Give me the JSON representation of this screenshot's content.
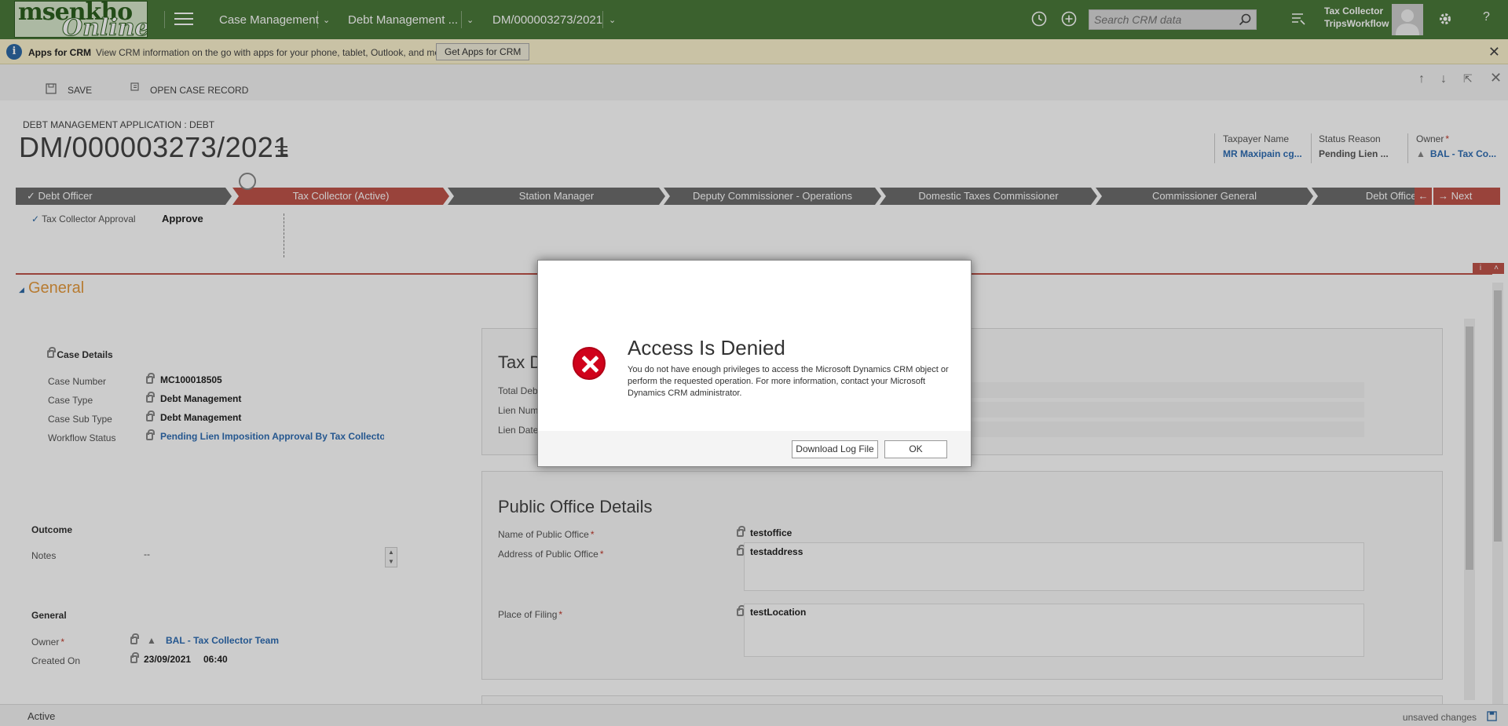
{
  "logo": {
    "line1": "msenkho",
    "line2": "Online"
  },
  "topbar": {
    "nav": [
      "Case Management",
      "Debt Management ...",
      "DM/000003273/2021"
    ],
    "search_placeholder": "Search CRM data",
    "user_line1": "Tax Collector",
    "user_line2": "TripsWorkflow",
    "help": "?"
  },
  "notification": {
    "title": "Apps for CRM",
    "message": "View CRM information on the go with apps for your phone, tablet, Outlook, and more!",
    "button": "Get Apps for CRM"
  },
  "commands": {
    "save": "SAVE",
    "open_case": "OPEN CASE RECORD"
  },
  "header": {
    "entity_type": "DEBT MANAGEMENT APPLICATION : DEBT",
    "title": "DM/000003273/2021",
    "fields": [
      {
        "label": "Taxpayer Name",
        "value": "MR Maxipain cg..."
      },
      {
        "label": "Status Reason",
        "value": "Pending Lien ..."
      },
      {
        "label": "Owner",
        "value": "BAL - Tax Co..."
      }
    ]
  },
  "process": {
    "stages": [
      "Debt Officer",
      "Tax Collector (Active)",
      "Station Manager",
      "Deputy Commissioner - Operations",
      "Domestic Taxes Commissioner",
      "Commissioner General",
      "Debt Officer"
    ],
    "next_stage": "Next Stage",
    "step_label": "Tax Collector Approval",
    "step_value": "Approve"
  },
  "section": {
    "title": "General"
  },
  "case_details": {
    "heading": "Case Details",
    "rows": [
      {
        "label": "Case Number",
        "value": "MC100018505"
      },
      {
        "label": "Case Type",
        "value": "Debt Management"
      },
      {
        "label": "Case Sub Type",
        "value": "Debt Management"
      },
      {
        "label": "Workflow Status",
        "value": "Pending Lien Imposition Approval By Tax Collecto"
      }
    ]
  },
  "outcome": {
    "heading": "Outcome",
    "notes_label": "Notes",
    "notes_value": "--"
  },
  "general": {
    "heading": "General",
    "owner_label": "Owner",
    "owner_value": "BAL - Tax Collector Team",
    "created_label": "Created On",
    "created_date": "23/09/2021",
    "created_time": "06:40"
  },
  "tax_panel": {
    "title": "Tax D",
    "fields": [
      "Total Debt",
      "Lien Num",
      "Lien Date"
    ]
  },
  "public_office": {
    "title": "Public Office Details",
    "fields": [
      {
        "label": "Name of Public Office",
        "value": "testoffice"
      },
      {
        "label": "Address of Public Office",
        "value": "testaddress"
      },
      {
        "label": "Place of Filing",
        "value": "testLocation"
      }
    ]
  },
  "footer": {
    "status": "Active",
    "unsaved": "unsaved changes"
  },
  "dialog": {
    "title": "Access Is Denied",
    "message": "You do not have enough privileges to access the Microsoft Dynamics CRM object or perform the requested operation. For more information, contact your Microsoft Dynamics CRM administrator.",
    "download_button": "Download Log File",
    "ok_button": "OK"
  },
  "colors": {
    "topbar": "#4a7a3a",
    "active_stage": "#c0544a",
    "stage": "#6d6d6d",
    "link": "#2f6db3",
    "section_title": "#e59a3e"
  }
}
